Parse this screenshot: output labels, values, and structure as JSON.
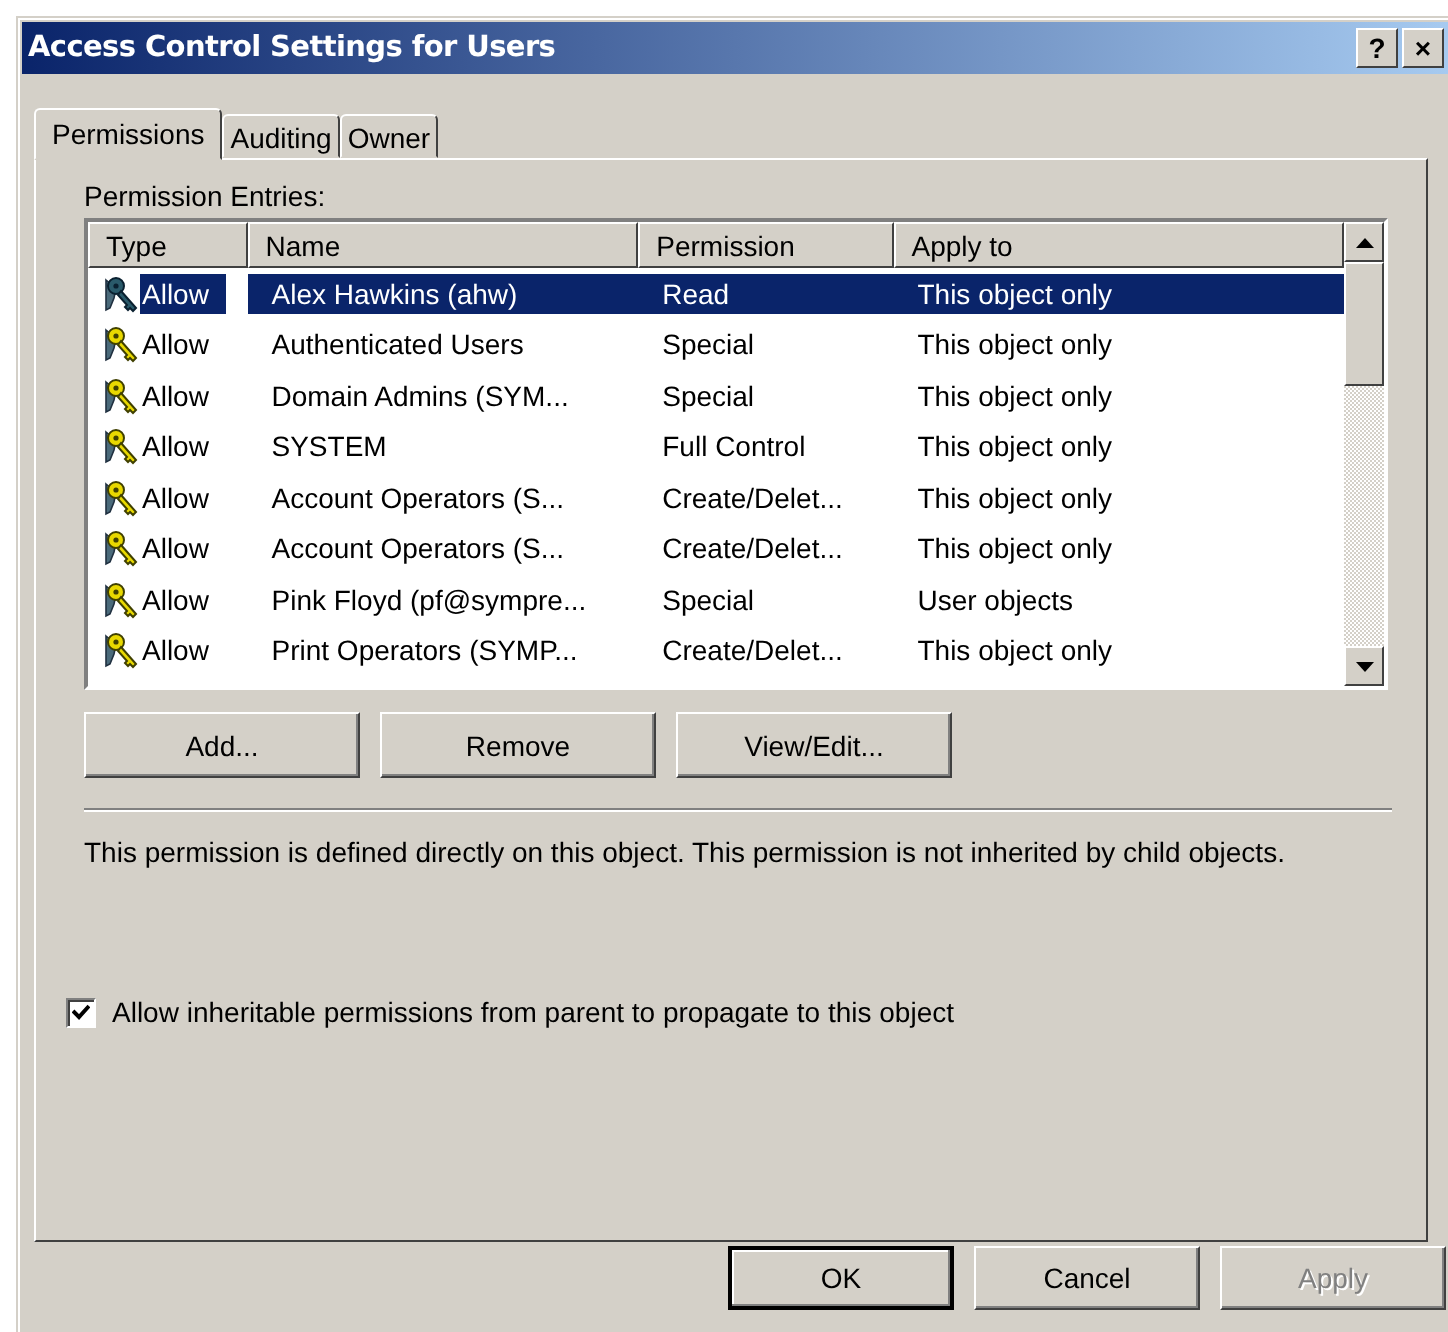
{
  "window": {
    "title": "Access Control Settings for Users",
    "help_button": "?",
    "close_button": "×"
  },
  "tabs": [
    {
      "label": "Permissions",
      "selected": true
    },
    {
      "label": "Auditing",
      "selected": false
    },
    {
      "label": "Owner",
      "selected": false
    }
  ],
  "entries_label": "Permission Entries:",
  "table": {
    "columns": [
      "Type",
      "Name",
      "Permission",
      "Apply to"
    ],
    "rows": [
      {
        "type": "Allow",
        "name": "Alex Hawkins (ahw)",
        "permission": "Read",
        "apply_to": "This object only",
        "selected": true
      },
      {
        "type": "Allow",
        "name": "Authenticated Users",
        "permission": "Special",
        "apply_to": "This object only",
        "selected": false
      },
      {
        "type": "Allow",
        "name": "Domain Admins (SYM...",
        "permission": "Special",
        "apply_to": "This object only",
        "selected": false
      },
      {
        "type": "Allow",
        "name": "SYSTEM",
        "permission": "Full Control",
        "apply_to": "This object only",
        "selected": false
      },
      {
        "type": "Allow",
        "name": "Account Operators (S...",
        "permission": "Create/Delet...",
        "apply_to": "This object only",
        "selected": false
      },
      {
        "type": "Allow",
        "name": "Account Operators (S...",
        "permission": "Create/Delet...",
        "apply_to": "This object only",
        "selected": false
      },
      {
        "type": "Allow",
        "name": "Pink Floyd (pf@sympre...",
        "permission": "Special",
        "apply_to": "User objects",
        "selected": false
      },
      {
        "type": "Allow",
        "name": "Print Operators (SYMP...",
        "permission": "Create/Delet...",
        "apply_to": "This object only",
        "selected": false
      }
    ]
  },
  "entry_buttons": [
    {
      "label": "Add...",
      "disabled": false
    },
    {
      "label": "Remove",
      "disabled": false
    },
    {
      "label": "View/Edit...",
      "disabled": false
    }
  ],
  "description": "This permission is defined directly on this object. This permission is not inherited by child objects.",
  "inherit_checkbox": {
    "label": "Allow inheritable permissions from parent to propagate to this object",
    "checked": true
  },
  "dialog_buttons": [
    {
      "label": "OK",
      "default": true,
      "disabled": false
    },
    {
      "label": "Cancel",
      "default": false,
      "disabled": false
    },
    {
      "label": "Apply",
      "default": false,
      "disabled": true
    }
  ]
}
